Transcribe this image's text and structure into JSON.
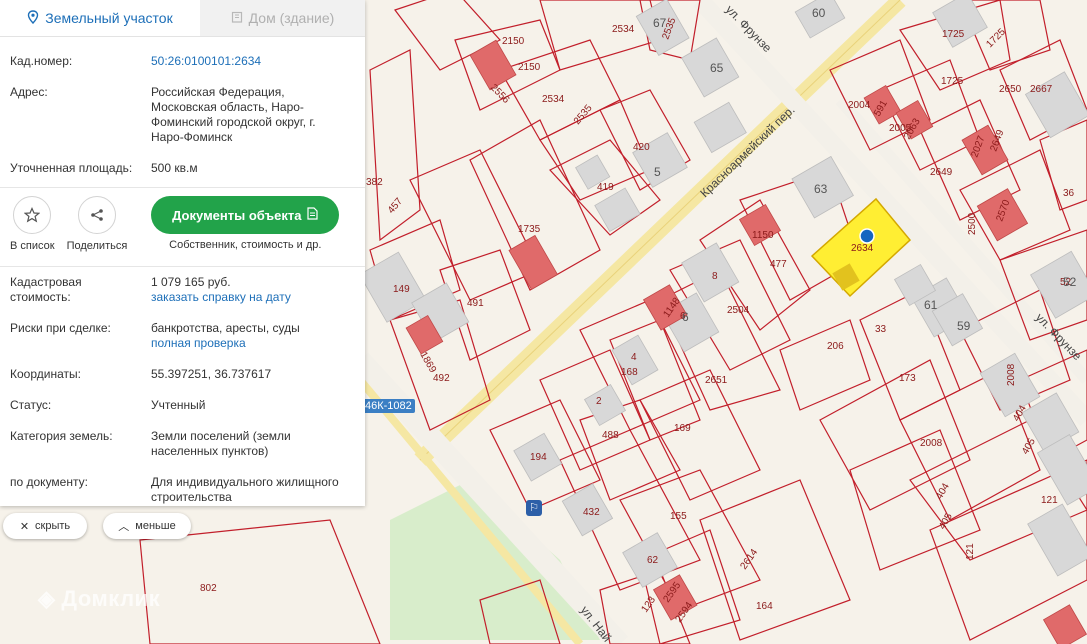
{
  "tabs": {
    "land": "Земельный участок",
    "house": "Дом (здание)"
  },
  "info": {
    "cad_label": "Кад.номер:",
    "cad_value": "50:26:0100101:2634",
    "addr_label": "Адрес:",
    "addr_lines": [
      "Российская Федерация,",
      "Московская область, Наро-",
      "Фоминский городской округ, г.",
      "Наро-Фоминск"
    ],
    "area_label": "Уточненная площадь:",
    "area_value": "500 кв.м"
  },
  "actions": {
    "list": "В список",
    "share": "Поделиться",
    "docs_button": "Документы объекта",
    "docs_sub": "Собственник, стоимость и др."
  },
  "details": {
    "cost_label_1": "Кадастровая",
    "cost_label_2": "стоимость:",
    "cost_value": "1 079 165 руб.",
    "cost_link": "заказать справку на дату",
    "risk_label": "Риски при сделке:",
    "risk_value": "банкротства, аресты, суды",
    "risk_link": "полная проверка",
    "coord_label": "Координаты:",
    "coord_value": "55.397251, 36.737617",
    "status_label": "Статус:",
    "status_value": "Учтенный",
    "cat_label": "Категория земель:",
    "cat_lines": [
      "Земли поселений (земли",
      "населенных пунктов)"
    ],
    "doc_label": "по документу:",
    "doc_lines": [
      "Для индивидуального жилищного",
      "строительства"
    ]
  },
  "controls": {
    "hide": "скрыть",
    "less": "меньше"
  },
  "map": {
    "road_badge": "46К-1082",
    "watermark": "Домклик",
    "streets": {
      "frunze_top": "ул. Фрунзе",
      "krasnoarm": "Красноармейский пер.",
      "frunze_right": "ул. Фрунзе",
      "nai": "ул. Най"
    },
    "selected_parcel": "2634",
    "parcel_labels": [
      "2150",
      "2150",
      "2534",
      "2535",
      "2556",
      "2534",
      "2535",
      "420",
      "419",
      "457",
      "382",
      "1735",
      "149",
      "491",
      "1869",
      "492",
      "1150",
      "477",
      "8",
      "2504",
      "1148",
      "6",
      "206",
      "33",
      "173",
      "2651",
      "4",
      "168",
      "2",
      "488",
      "169",
      "194",
      "432",
      "155",
      "62",
      "2614",
      "2595",
      "123",
      "2594",
      "164",
      "802",
      "2004",
      "591",
      "2005",
      "2063",
      "2649",
      "2027",
      "2649",
      "2650",
      "2667",
      "1725",
      "1725",
      "2570",
      "2500",
      "36",
      "2008",
      "404",
      "405",
      "2008",
      "404",
      "405",
      "121",
      "121",
      "52",
      "1725"
    ],
    "house_labels": [
      "67",
      "60",
      "65",
      "5",
      "63",
      "61",
      "59",
      "6",
      "52"
    ],
    "marker_color": "#1565c0",
    "selected_fill": "#ffee33"
  }
}
